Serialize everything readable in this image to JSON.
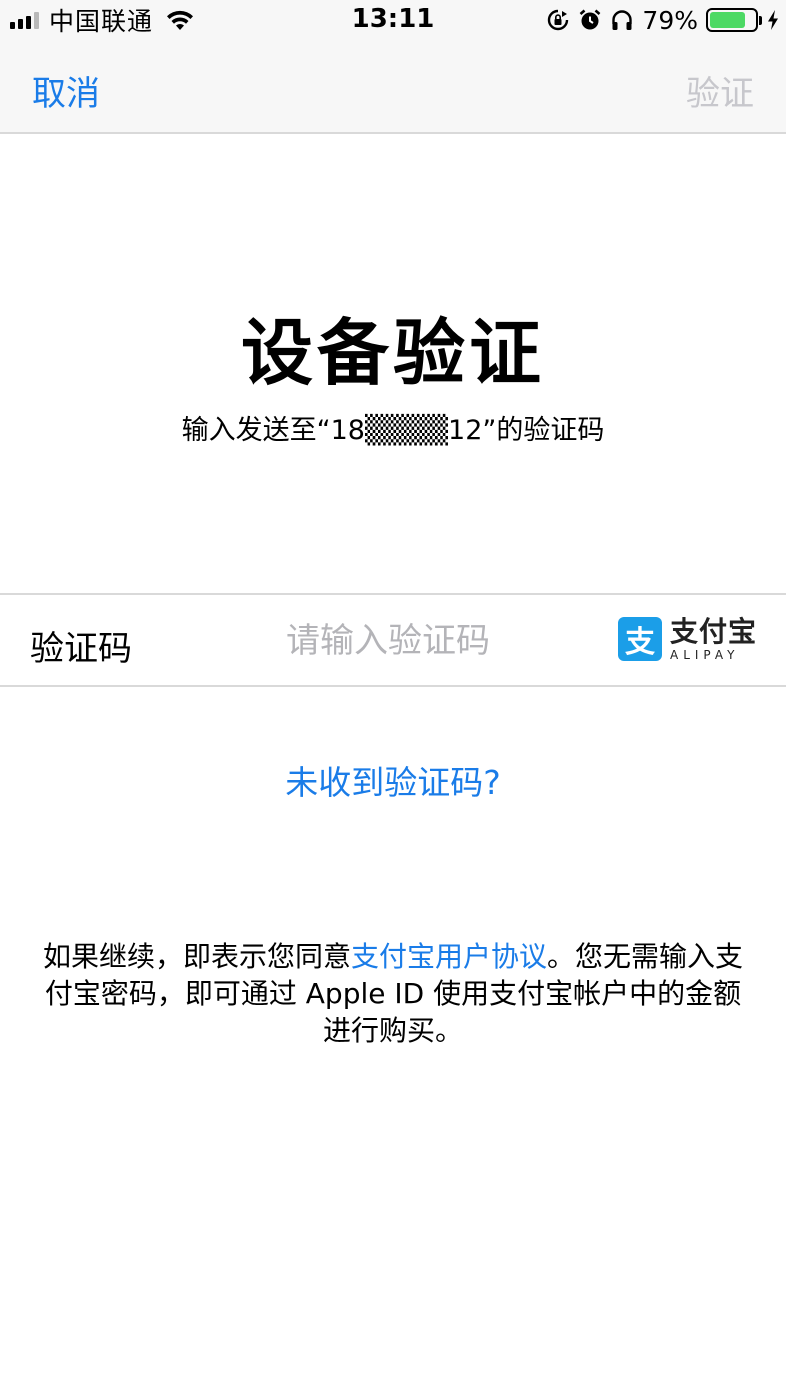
{
  "status_bar": {
    "carrier": "中国联通",
    "time": "13:11",
    "battery_percent": "79%",
    "battery_level": 0.79,
    "icons": [
      "signal-icon",
      "wifi-icon",
      "rotation-lock-icon",
      "alarm-icon",
      "headphones-icon",
      "battery-icon",
      "charging-bolt-icon"
    ]
  },
  "nav": {
    "cancel_label": "取消",
    "verify_label": "验证"
  },
  "header": {
    "title": "设备验证",
    "subtitle": "输入发送至“18▒▒▒▒12”的验证码"
  },
  "input_row": {
    "label": "验证码",
    "placeholder": "请输入验证码",
    "value": ""
  },
  "alipay_logo": {
    "badge": "支",
    "name_cn": "支付宝",
    "name_en": "ALIPAY"
  },
  "resend_link": "未收到验证码?",
  "agreement": {
    "prefix": "如果继续，即表示您同意",
    "link_text": "支付宝用户协议",
    "suffix": "。您无需输入支付宝密码，即可通过 Apple ID 使用支付宝帐户中的金额进行购买。"
  },
  "colors": {
    "accent": "#1a7ce8",
    "disabled": "#c7c7cc",
    "alipay_blue": "#1b9ee8",
    "battery_green": "#4cd964"
  }
}
